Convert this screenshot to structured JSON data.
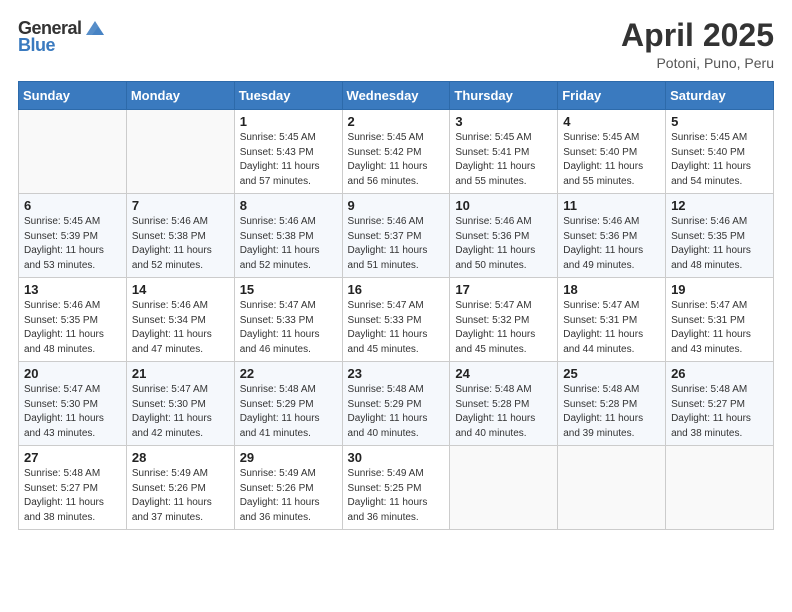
{
  "header": {
    "logo_general": "General",
    "logo_blue": "Blue",
    "title": "April 2025",
    "location": "Potoni, Puno, Peru"
  },
  "days_of_week": [
    "Sunday",
    "Monday",
    "Tuesday",
    "Wednesday",
    "Thursday",
    "Friday",
    "Saturday"
  ],
  "weeks": [
    [
      {
        "day": "",
        "info": ""
      },
      {
        "day": "",
        "info": ""
      },
      {
        "day": "1",
        "info": "Sunrise: 5:45 AM\nSunset: 5:43 PM\nDaylight: 11 hours and 57 minutes."
      },
      {
        "day": "2",
        "info": "Sunrise: 5:45 AM\nSunset: 5:42 PM\nDaylight: 11 hours and 56 minutes."
      },
      {
        "day": "3",
        "info": "Sunrise: 5:45 AM\nSunset: 5:41 PM\nDaylight: 11 hours and 55 minutes."
      },
      {
        "day": "4",
        "info": "Sunrise: 5:45 AM\nSunset: 5:40 PM\nDaylight: 11 hours and 55 minutes."
      },
      {
        "day": "5",
        "info": "Sunrise: 5:45 AM\nSunset: 5:40 PM\nDaylight: 11 hours and 54 minutes."
      }
    ],
    [
      {
        "day": "6",
        "info": "Sunrise: 5:45 AM\nSunset: 5:39 PM\nDaylight: 11 hours and 53 minutes."
      },
      {
        "day": "7",
        "info": "Sunrise: 5:46 AM\nSunset: 5:38 PM\nDaylight: 11 hours and 52 minutes."
      },
      {
        "day": "8",
        "info": "Sunrise: 5:46 AM\nSunset: 5:38 PM\nDaylight: 11 hours and 52 minutes."
      },
      {
        "day": "9",
        "info": "Sunrise: 5:46 AM\nSunset: 5:37 PM\nDaylight: 11 hours and 51 minutes."
      },
      {
        "day": "10",
        "info": "Sunrise: 5:46 AM\nSunset: 5:36 PM\nDaylight: 11 hours and 50 minutes."
      },
      {
        "day": "11",
        "info": "Sunrise: 5:46 AM\nSunset: 5:36 PM\nDaylight: 11 hours and 49 minutes."
      },
      {
        "day": "12",
        "info": "Sunrise: 5:46 AM\nSunset: 5:35 PM\nDaylight: 11 hours and 48 minutes."
      }
    ],
    [
      {
        "day": "13",
        "info": "Sunrise: 5:46 AM\nSunset: 5:35 PM\nDaylight: 11 hours and 48 minutes."
      },
      {
        "day": "14",
        "info": "Sunrise: 5:46 AM\nSunset: 5:34 PM\nDaylight: 11 hours and 47 minutes."
      },
      {
        "day": "15",
        "info": "Sunrise: 5:47 AM\nSunset: 5:33 PM\nDaylight: 11 hours and 46 minutes."
      },
      {
        "day": "16",
        "info": "Sunrise: 5:47 AM\nSunset: 5:33 PM\nDaylight: 11 hours and 45 minutes."
      },
      {
        "day": "17",
        "info": "Sunrise: 5:47 AM\nSunset: 5:32 PM\nDaylight: 11 hours and 45 minutes."
      },
      {
        "day": "18",
        "info": "Sunrise: 5:47 AM\nSunset: 5:31 PM\nDaylight: 11 hours and 44 minutes."
      },
      {
        "day": "19",
        "info": "Sunrise: 5:47 AM\nSunset: 5:31 PM\nDaylight: 11 hours and 43 minutes."
      }
    ],
    [
      {
        "day": "20",
        "info": "Sunrise: 5:47 AM\nSunset: 5:30 PM\nDaylight: 11 hours and 43 minutes."
      },
      {
        "day": "21",
        "info": "Sunrise: 5:47 AM\nSunset: 5:30 PM\nDaylight: 11 hours and 42 minutes."
      },
      {
        "day": "22",
        "info": "Sunrise: 5:48 AM\nSunset: 5:29 PM\nDaylight: 11 hours and 41 minutes."
      },
      {
        "day": "23",
        "info": "Sunrise: 5:48 AM\nSunset: 5:29 PM\nDaylight: 11 hours and 40 minutes."
      },
      {
        "day": "24",
        "info": "Sunrise: 5:48 AM\nSunset: 5:28 PM\nDaylight: 11 hours and 40 minutes."
      },
      {
        "day": "25",
        "info": "Sunrise: 5:48 AM\nSunset: 5:28 PM\nDaylight: 11 hours and 39 minutes."
      },
      {
        "day": "26",
        "info": "Sunrise: 5:48 AM\nSunset: 5:27 PM\nDaylight: 11 hours and 38 minutes."
      }
    ],
    [
      {
        "day": "27",
        "info": "Sunrise: 5:48 AM\nSunset: 5:27 PM\nDaylight: 11 hours and 38 minutes."
      },
      {
        "day": "28",
        "info": "Sunrise: 5:49 AM\nSunset: 5:26 PM\nDaylight: 11 hours and 37 minutes."
      },
      {
        "day": "29",
        "info": "Sunrise: 5:49 AM\nSunset: 5:26 PM\nDaylight: 11 hours and 36 minutes."
      },
      {
        "day": "30",
        "info": "Sunrise: 5:49 AM\nSunset: 5:25 PM\nDaylight: 11 hours and 36 minutes."
      },
      {
        "day": "",
        "info": ""
      },
      {
        "day": "",
        "info": ""
      },
      {
        "day": "",
        "info": ""
      }
    ]
  ]
}
